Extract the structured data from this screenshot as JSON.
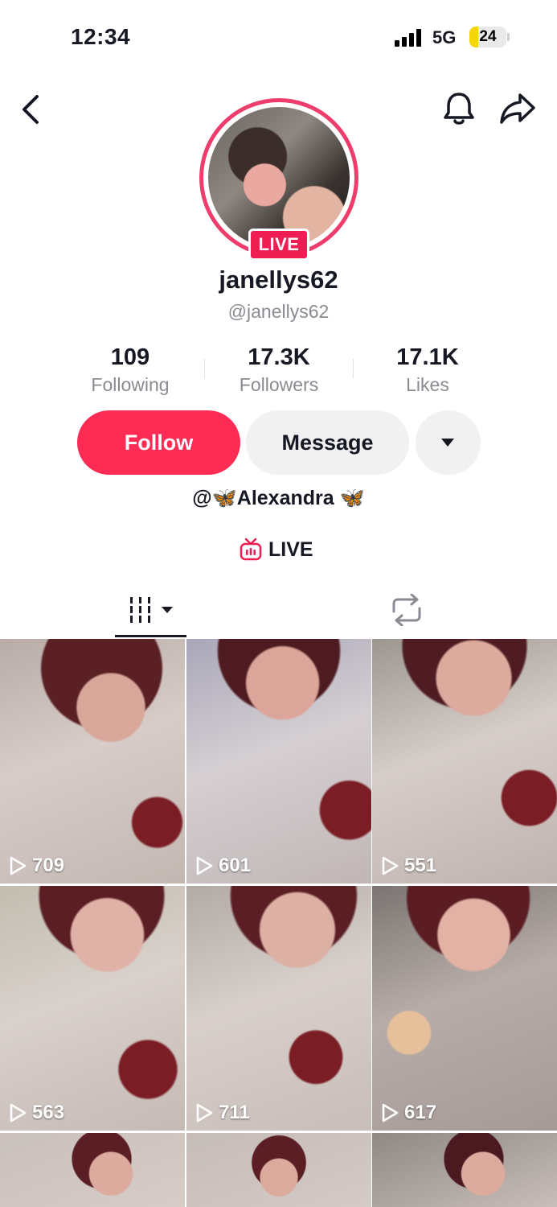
{
  "status_bar": {
    "time": "12:34",
    "network": "5G",
    "battery_level": "24",
    "battery_fraction": 0.24
  },
  "nav": {
    "back_icon": "chevron-left-icon",
    "bell_icon": "bell-icon",
    "share_icon": "share-arrow-icon"
  },
  "profile": {
    "live_badge": "LIVE",
    "display_name": "janellys62",
    "handle": "@janellys62",
    "stats": {
      "following_value": "109",
      "following_label": "Following",
      "followers_value": "17.3K",
      "followers_label": "Followers",
      "likes_value": "17.1K",
      "likes_label": "Likes"
    },
    "buttons": {
      "follow": "Follow",
      "message": "Message"
    },
    "bio": {
      "prefix": "@",
      "butterfly_left": "🦋",
      "name": "Alexandra",
      "butterfly_right": " 🦋"
    },
    "live_link_label": "LIVE"
  },
  "tabs": {
    "videos_icon": "grid-lines-icon",
    "reposts_icon": "repost-icon"
  },
  "videos": [
    {
      "views": "709"
    },
    {
      "views": "601"
    },
    {
      "views": "551"
    },
    {
      "views": "563"
    },
    {
      "views": "711"
    },
    {
      "views": "617"
    },
    {
      "views": ""
    },
    {
      "views": ""
    },
    {
      "views": ""
    }
  ],
  "colors": {
    "accent": "#fe2c55",
    "live": "#ee1d52",
    "text_primary": "#161823",
    "text_secondary": "#8a8b91",
    "button_grey": "#f1f1f2"
  }
}
